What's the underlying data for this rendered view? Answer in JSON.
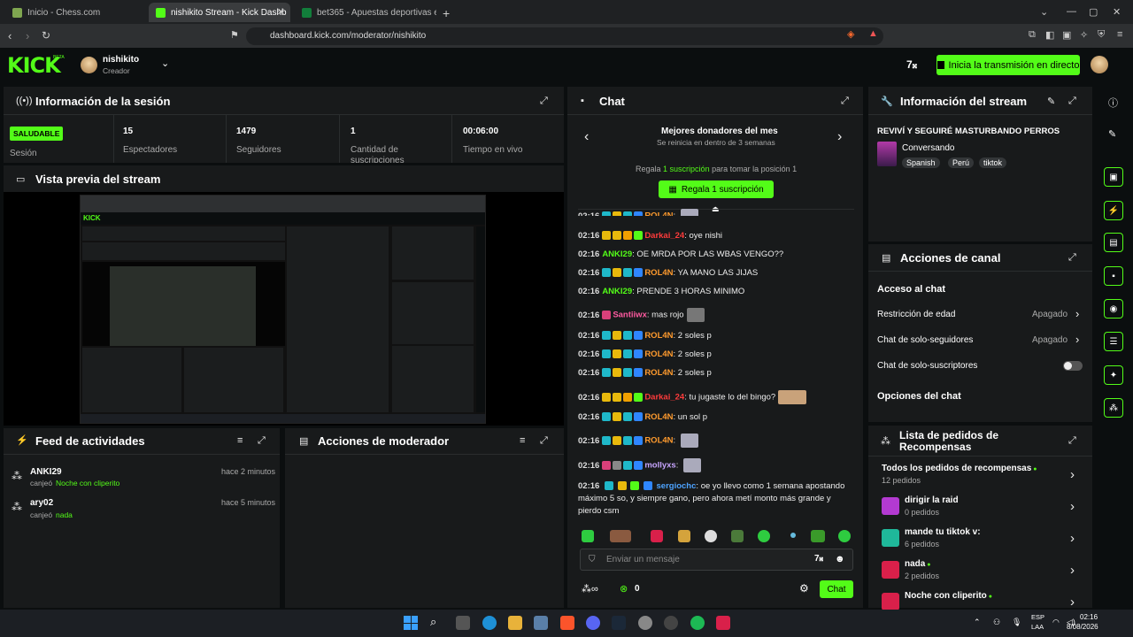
{
  "browser": {
    "tabs": [
      {
        "title": "Inicio - Chess.com"
      },
      {
        "title": "nishikito Stream - Kick Dashb"
      },
      {
        "title": "bet365 - Apuestas deportivas en la m"
      }
    ],
    "url": "dashboard.kick.com/moderator/nishikito"
  },
  "header": {
    "brand": "KICK",
    "beta": "BETA",
    "user_name": "nishikito",
    "user_role": "Creador",
    "live_button": "Inicia la transmisión en directo"
  },
  "session": {
    "title": "Información de la sesión",
    "badge": "SALUDABLE",
    "badge_label": "Sesión",
    "stats": [
      {
        "value": "15",
        "label": "Espectadores"
      },
      {
        "value": "1479",
        "label": "Seguidores"
      },
      {
        "value": "1",
        "label": "Cantidad de suscripciones"
      },
      {
        "value": "00:06:00",
        "label": "Tiempo en vivo"
      }
    ]
  },
  "preview": {
    "title": "Vista previa del stream"
  },
  "activity": {
    "title": "Feed de actividades",
    "items": [
      {
        "user": "ANKI29",
        "action": "canjeó",
        "reward": "Noche con cliperito",
        "time": "hace 2 minutos"
      },
      {
        "user": "ary02",
        "action": "canjeó",
        "reward": "nada",
        "time": "hace 5 minutos"
      }
    ]
  },
  "moderator": {
    "title": "Acciones de moderador"
  },
  "chat": {
    "title": "Chat",
    "donors_title": "Mejores donadores del mes",
    "donors_sub": "Se reinicia en dentro de 3 semanas",
    "gift_pre": "Regala",
    "gift_link": "1 suscripción",
    "gift_post": "para tomar la posición 1",
    "gift_button": "Regala 1 suscripción",
    "messages": [
      {
        "time": "02:16",
        "user": "ROL4N",
        "color": "#ff9b2e",
        "text": ""
      },
      {
        "time": "02:16",
        "user": "Darkai_24",
        "color": "#ff3b3b",
        "text": "oye nishi"
      },
      {
        "time": "02:16",
        "user": "ANKI29",
        "color": "#53fc18",
        "text": "OE MRDA POR LAS WBAS VENGO??"
      },
      {
        "time": "02:16",
        "user": "ROL4N",
        "color": "#ff9b2e",
        "text": "YA MANO LAS JIJAS"
      },
      {
        "time": "02:16",
        "user": "ANKI29",
        "color": "#53fc18",
        "text": "PRENDE 3 HORAS MINIMO"
      },
      {
        "time": "02:16",
        "user": "Santiiwx",
        "color": "#ff5aa0",
        "text": "mas rojo"
      },
      {
        "time": "02:16",
        "user": "ROL4N",
        "color": "#ff9b2e",
        "text": "2 soles p"
      },
      {
        "time": "02:16",
        "user": "ROL4N",
        "color": "#ff9b2e",
        "text": "2 soles p"
      },
      {
        "time": "02:16",
        "user": "ROL4N",
        "color": "#ff9b2e",
        "text": "2 soles p"
      },
      {
        "time": "02:16",
        "user": "Darkai_24",
        "color": "#ff3b3b",
        "text": "tu jugaste lo del bingo?"
      },
      {
        "time": "02:16",
        "user": "ROL4N",
        "color": "#ff9b2e",
        "text": "un sol p"
      },
      {
        "time": "02:16",
        "user": "ROL4N",
        "color": "#ff9b2e",
        "text": ""
      },
      {
        "time": "02:16",
        "user": "mollyxs",
        "color": "#c7a5ff",
        "text": ""
      }
    ],
    "long_msg": {
      "time": "02:16",
      "user": "sergiochc",
      "color": "#4da3ff",
      "line1": "oe yo llevo como 1 semana apostando",
      "line2": "máximo 5 so, y siempre gano, pero ahora metí monto más grande y",
      "line3": "pierdo csm"
    },
    "input_placeholder": "Enviar un mensaje",
    "viewer_count": "0",
    "send_button": "Chat"
  },
  "stream_info": {
    "title": "Información del stream",
    "stream_title": "REVIVÍ Y SEGUIRÉ MASTURBANDO PERROS",
    "category": "Conversando",
    "tags": [
      "Spanish",
      "Perú",
      "tiktok"
    ]
  },
  "channel_actions": {
    "title": "Acciones de canal",
    "section1": "Acceso al chat",
    "rows": [
      {
        "label": "Restricción de edad",
        "value": "Apagado"
      },
      {
        "label": "Chat de solo-seguidores",
        "value": "Apagado"
      },
      {
        "label": "Chat de solo-suscriptores",
        "value": ""
      }
    ],
    "section2": "Opciones del chat"
  },
  "rewards": {
    "title_line1": "Lista de pedidos de",
    "title_line2": "Recompensas",
    "items": [
      {
        "name": "Todos los pedidos de recompensas",
        "count": "12 pedidos",
        "color": ""
      },
      {
        "name": "dirigir la raid",
        "count": "0 pedidos",
        "color": "#b33ad1"
      },
      {
        "name": "mande tu tiktok v:",
        "count": "6 pedidos",
        "color": "#1fb89a"
      },
      {
        "name": "nada",
        "count": "2 pedidos",
        "color": "#d9204a"
      },
      {
        "name": "Noche con cliperito",
        "count": "",
        "color": "#d9204a"
      }
    ]
  },
  "taskbar": {
    "lang": "ESP",
    "region": "LAA",
    "time": "02:16",
    "date": "8/08/2026"
  }
}
